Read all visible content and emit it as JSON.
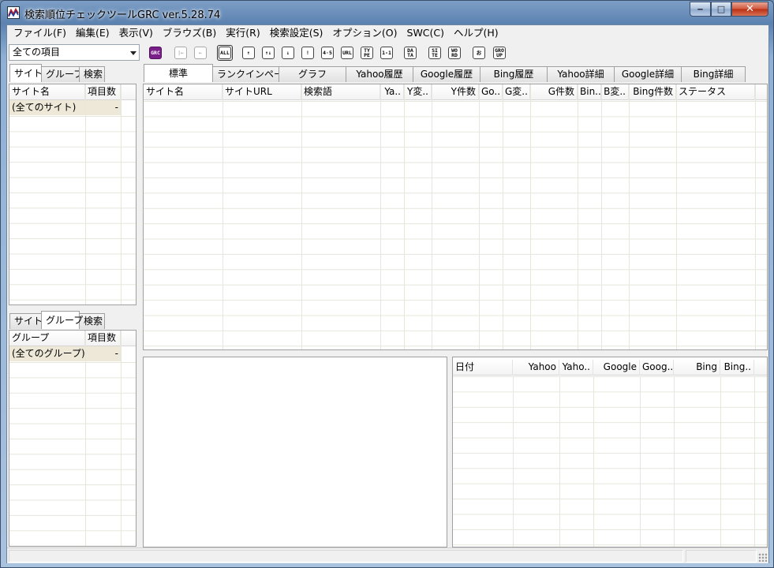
{
  "window": {
    "title": "検索順位チェックツールGRC  ver.5.28.74",
    "minimize": "‒",
    "maximize": "□",
    "close": "✕"
  },
  "menu": [
    "ファイル(F)",
    "編集(E)",
    "表示(V)",
    "ブラウズ(B)",
    "実行(R)",
    "検索設定(S)",
    "オプション(O)",
    "SWC(C)",
    "ヘルプ(H)"
  ],
  "filter_combo": {
    "value": "全ての項目"
  },
  "toolbar": {
    "grc": "GRC",
    "first": "|←",
    "prev": "←",
    "all": "ALL",
    "up": "↑",
    "updown": "↑↓",
    "down": "↓",
    "excl": "!",
    "n45": "4·5",
    "url": "URL",
    "type": "TY PE",
    "n11": "1-1",
    "data": "DA TA",
    "site": "SI TE",
    "word": "WO RD",
    "o": "お",
    "group": "GRO UP"
  },
  "left_top": {
    "tabs": [
      "サイト",
      "グループ",
      "検索"
    ],
    "columns": [
      "サイト名",
      "項目数"
    ],
    "rows": [
      {
        "name": "(全てのサイト)",
        "count": "-"
      }
    ]
  },
  "left_bottom": {
    "tabs": [
      "サイト",
      "グループ",
      "検索"
    ],
    "columns": [
      "グループ",
      "項目数"
    ],
    "rows": [
      {
        "name": "(全てのグループ)",
        "count": "-"
      }
    ]
  },
  "main_tabs": [
    "標準",
    "ランクインページ",
    "グラフ",
    "Yahoo履歴",
    "Google履歴",
    "Bing履歴",
    "Yahoo詳細",
    "Google詳細",
    "Bing詳細"
  ],
  "main_columns": [
    "サイト名",
    "サイトURL",
    "検索語",
    "Ya..",
    "Y変..",
    "Y件数",
    "Go..",
    "G変..",
    "G件数",
    "Bin..",
    "B変..",
    "Bing件数",
    "ステータス"
  ],
  "history_columns": [
    "日付",
    "Yahoo",
    "Yaho..",
    "Google",
    "Goog..",
    "Bing",
    "Bing.."
  ]
}
